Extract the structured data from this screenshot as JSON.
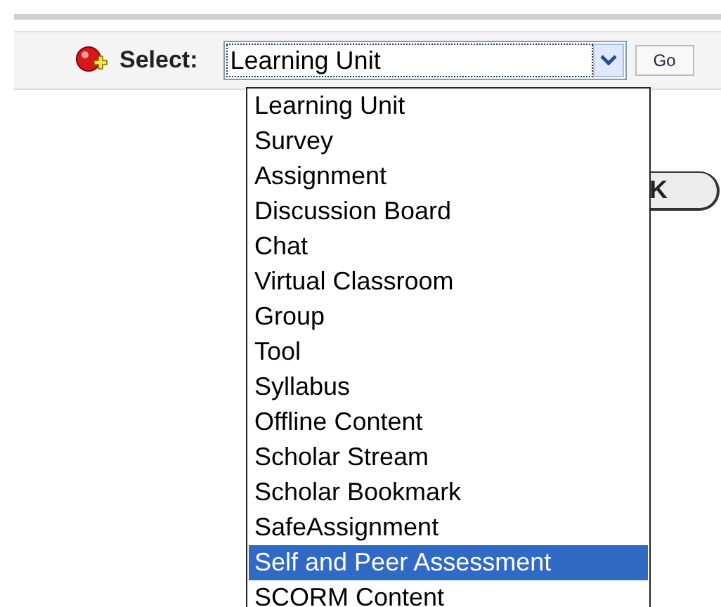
{
  "toolbar": {
    "label": "Select:",
    "select_value": "Learning Unit",
    "go_button": "Go"
  },
  "dropdown_options": [
    {
      "label": "Learning Unit",
      "selected": false
    },
    {
      "label": "Survey",
      "selected": false
    },
    {
      "label": "Assignment",
      "selected": false
    },
    {
      "label": "Discussion Board",
      "selected": false
    },
    {
      "label": "Chat",
      "selected": false
    },
    {
      "label": "Virtual Classroom",
      "selected": false
    },
    {
      "label": "Group",
      "selected": false
    },
    {
      "label": "Tool",
      "selected": false
    },
    {
      "label": "Syllabus",
      "selected": false
    },
    {
      "label": "Offline Content",
      "selected": false
    },
    {
      "label": "Scholar Stream",
      "selected": false
    },
    {
      "label": "Scholar Bookmark",
      "selected": false
    },
    {
      "label": "SafeAssignment",
      "selected": false
    },
    {
      "label": "Self and Peer Assessment",
      "selected": true
    },
    {
      "label": "SCORM Content",
      "selected": false
    }
  ],
  "background_button": {
    "label": "K"
  }
}
